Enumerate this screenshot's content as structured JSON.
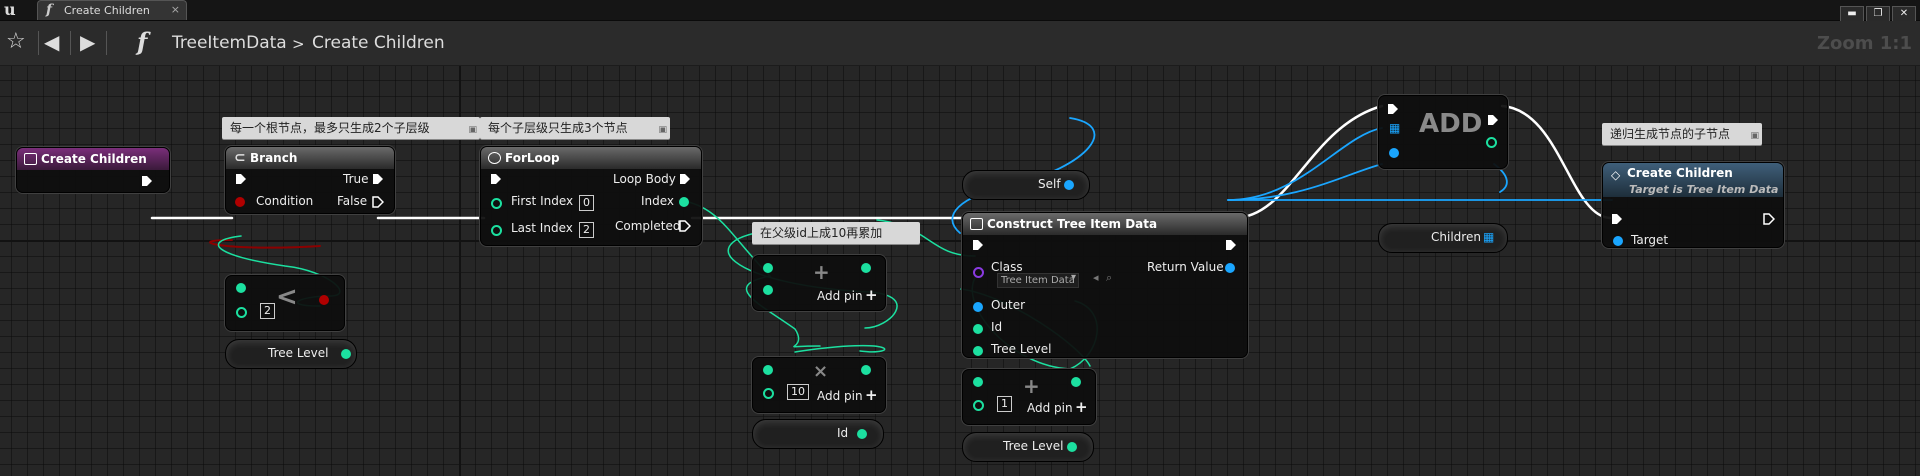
{
  "tab": {
    "title": "Create Children",
    "close": "×"
  },
  "window": {
    "minimize": "▬",
    "restore": "❐",
    "close": "✕"
  },
  "breadcrumb": {
    "class_name": "TreeItemData",
    "separator": ">",
    "function_name": "Create Children"
  },
  "zoom": "Zoom 1:1",
  "comments": {
    "branch": "每一个根节点，最多只生成2个子层级",
    "forloop": "每个子层级只生成3个节点",
    "add": "在父级id上成10再累加",
    "create_children": "递归生成节点的子节点"
  },
  "entry": {
    "title": "Create Children"
  },
  "branch": {
    "title": "Branch",
    "condition": "Condition",
    "true_label": "True",
    "false_label": "False"
  },
  "less": {
    "op": "<",
    "value": "2"
  },
  "tree_level_1": {
    "label": "Tree Level"
  },
  "forloop": {
    "title": "ForLoop",
    "first_index": "First Index",
    "first_value": "0",
    "last_index": "Last Index",
    "last_value": "2",
    "loop_body": "Loop Body",
    "index": "Index",
    "completed": "Completed"
  },
  "add1": {
    "op": "+",
    "add_pin": "Add pin"
  },
  "mul": {
    "op": "×",
    "value": "10",
    "add_pin": "Add pin"
  },
  "id_getter": {
    "label": "Id"
  },
  "self_node": {
    "label": "Self"
  },
  "construct": {
    "title": "Construct Tree Item Data",
    "class_label": "Class",
    "class_value": "Tree Item Data",
    "outer": "Outer",
    "id": "Id",
    "tree_level": "Tree Level",
    "return_value": "Return Value"
  },
  "add2": {
    "op": "+",
    "value": "1",
    "add_pin": "Add pin"
  },
  "tree_level_2": {
    "label": "Tree Level"
  },
  "array_add": {
    "title": "ADD"
  },
  "children": {
    "label": "Children"
  },
  "create_children_call": {
    "title": "Create Children",
    "subtitle": "Target is Tree Item Data",
    "target": "Target"
  },
  "colors": {
    "exec": "#ffffff",
    "int": "#1ce0a0",
    "object": "#1aa6ff",
    "bool": "#b00000",
    "function_header": "#6a6a6a",
    "event_header": "#7a2e7a",
    "call_header": "#3f5f7a"
  }
}
